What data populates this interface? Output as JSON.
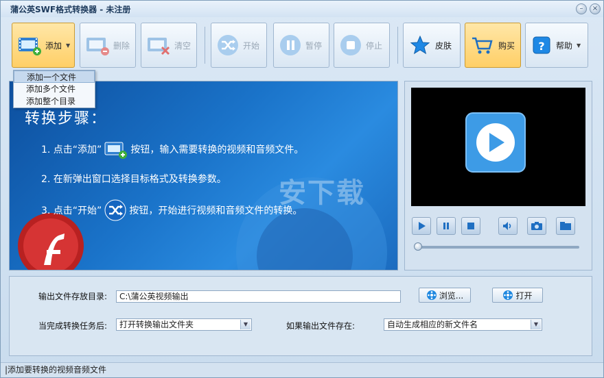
{
  "window": {
    "title": "蒲公英SWF格式转换器 - 未注册"
  },
  "toolbar": {
    "add": "添加",
    "delete": "删除",
    "clear": "清空",
    "start": "开始",
    "pause": "暂停",
    "stop": "停止",
    "skin": "皮肤",
    "buy": "购买",
    "help": "帮助"
  },
  "add_menu": {
    "items": [
      "添加一个文件",
      "添加多个文件",
      "添加整个目录"
    ]
  },
  "guide": {
    "title": "转换步骤：",
    "step1_a": "1. 点击“添加”",
    "step1_b": "按钮，输入需要转换的视频和音频文件。",
    "step2": "2. 在新弹出窗口选择目标格式及转换参数。",
    "step3_a": "3. 点击“开始”",
    "step3_b": "按钮，开始进行视频和音频文件的转换。",
    "watermark": "安下载"
  },
  "player": {
    "seek_position": 0
  },
  "settings": {
    "output_dir_label": "输出文件存放目录:",
    "output_dir_value": "C:\\蒲公英视频输出",
    "browse": "浏览...",
    "open": "打开",
    "after_task_label": "当完成转换任务后:",
    "after_task_value": "打开转换输出文件夹",
    "if_exists_label": "如果输出文件存在:",
    "if_exists_value": "自动生成相应的新文件名"
  },
  "status": {
    "text": "|添加要转换的视频音频文件"
  },
  "colors": {
    "accent": "#1a73c9",
    "highlight": "#ffcf66",
    "player_icon": "#4aa3e8"
  }
}
